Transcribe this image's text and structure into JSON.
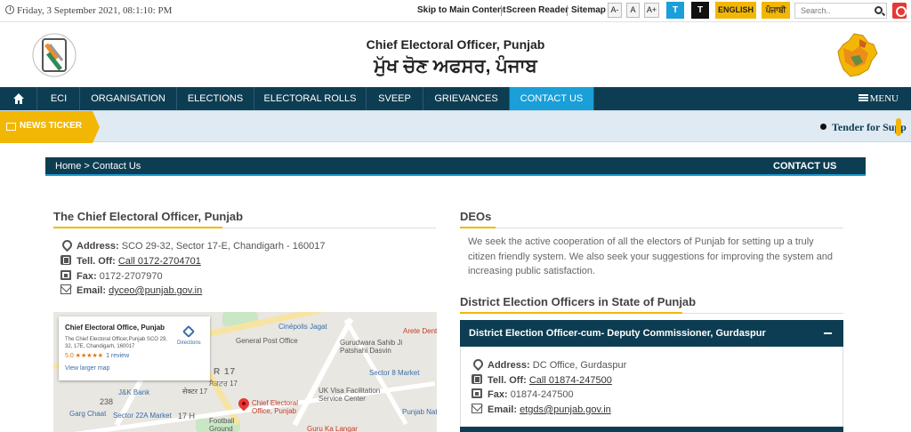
{
  "topbar": {
    "datetime": "Friday, 3 September 2021, 08:1:10: PM",
    "skip_link": "Skip to Main Content",
    "screen_reader": "Screen Reader",
    "sitemap": "Sitemap",
    "font_minus": "A-",
    "font_normal": "A",
    "font_plus": "A+",
    "theme_light": "T",
    "theme_dark": "T",
    "lang_english": "ENGLISH",
    "lang_punjabi": "ਪੰਜਾਬੀ",
    "search_placeholder": "Search..",
    "icons": [
      "clock-icon",
      "search-icon",
      "power-icon"
    ]
  },
  "header": {
    "title_en": "Chief Electoral Officer, Punjab",
    "title_pa": "ਮੁੱਖ ਚੋਣ ਅਫਸਰ, ਪੰਜਾਬ"
  },
  "nav": {
    "items": [
      "ECI",
      "ORGANISATION",
      "ELECTIONS",
      "ELECTORAL ROLLS",
      "SVEEP",
      "GRIEVANCES",
      "CONTACT US"
    ],
    "active": "CONTACT US",
    "menu": "MENU"
  },
  "ticker": {
    "label": "NEWS TICKER",
    "text": "Tender for Supp"
  },
  "breadcrumb": {
    "path": "Home > Contact Us",
    "page_title": "CONTACT US"
  },
  "ceo": {
    "heading": "The Chief Electoral Officer, Punjab",
    "address_label": "Address:",
    "address": "SCO 29-32, Sector 17-E, Chandigarh - 160017",
    "tel_label": "Tell. Off:",
    "tel": "Call 0172-2704701",
    "fax_label": "Fax:",
    "fax": "0172-2707970",
    "email_label": "Email:",
    "email": "dyceo@punjab.gov.in"
  },
  "map": {
    "place_name": "Chief Electoral Office, Punjab",
    "place_address": "The Chief Electoral Officer,Punjab SCO 29, 32, 17E, Chandigarh, 160017",
    "rating": "5.0 ★★★★★",
    "reviews": "1 review",
    "directions": "Directions",
    "larger_map": "View larger map",
    "labels": {
      "cinepolis": "Cinépolis Jagat",
      "gpo": "General Post Office",
      "gurudwara": "Gurudwara Sahib Ji Patshahi Dasvin",
      "arete": "Arete Denta",
      "sector8": "Sector 8 Market",
      "sector17_big": "R 17",
      "sector17_pa": "ਸੈਕਟਰ 17",
      "sector17_hi": "सेक्टर 17",
      "jkbank": "J&K Bank",
      "num238": "238",
      "uk_visa": "UK Visa Facilitation Service Center",
      "punjab_nat": "Punjab Nat",
      "garg": "Garg Chaat",
      "sector22": "Sector 22A Market",
      "h17": "17 H",
      "football": "Football Ground",
      "marker_label": "Chief Electoral Office, Punjab",
      "guru": "Guru Ka Langar"
    }
  },
  "deos": {
    "heading": "DEOs",
    "description": "We seek the active cooperation of all the electors of Punjab for setting up a truly citizen friendly system. We also seek your suggestions for improving the system and increasing public satisfaction.",
    "district_heading": "District Election Officers in State of Punjab",
    "accordion_title": "District Election Officer-cum- Deputy Commissioner, Gurdaspur",
    "address_label": "Address:",
    "address": "DC Office, Gurdaspur",
    "tel_label": "Tell. Off:",
    "tel": "Call 01874-247500",
    "fax_label": "Fax:",
    "fax": "01874-247500",
    "email_label": "Email:",
    "email": "etgds@punjab.gov.in"
  },
  "colors": {
    "nav_bg": "#0d3d52",
    "nav_active": "#1a9fd8",
    "accent_yellow": "#f2b705",
    "ticker_bg": "#dfeaf2"
  }
}
